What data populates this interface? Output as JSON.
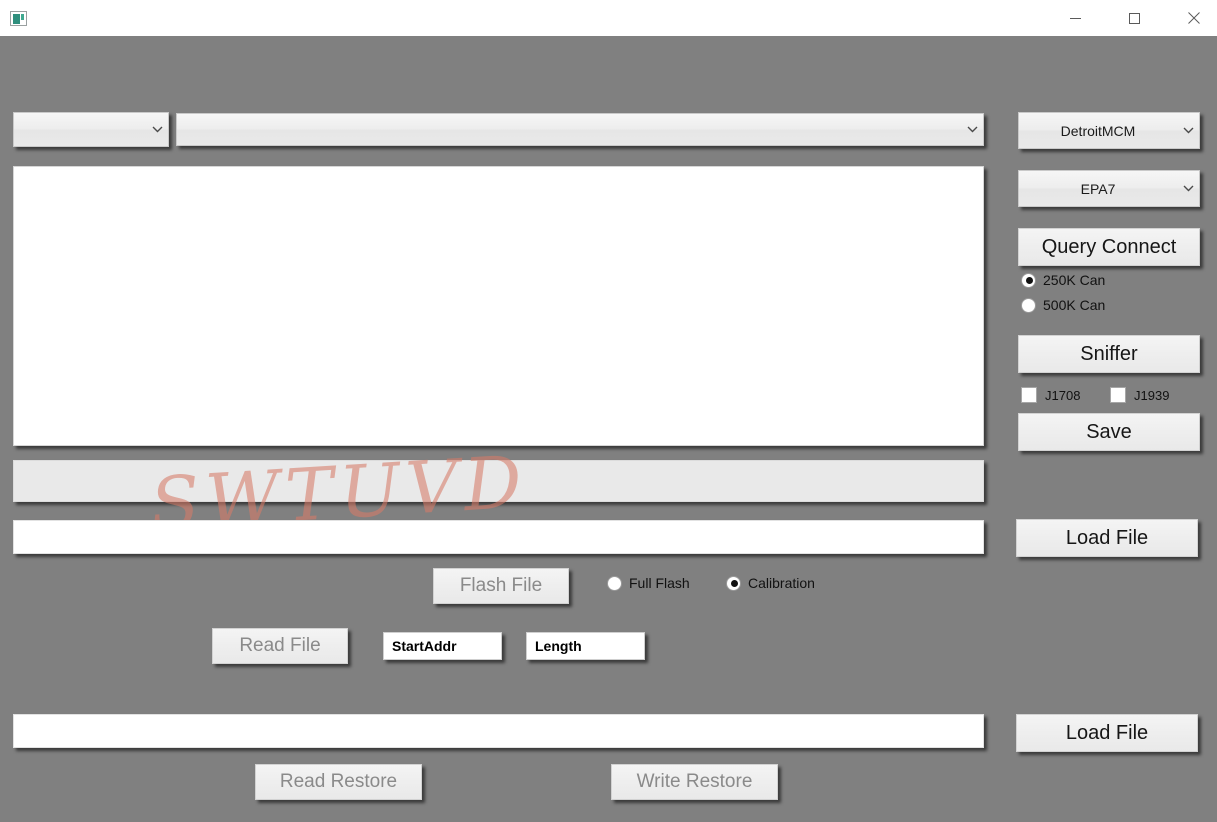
{
  "window": {
    "title": "",
    "icon": "app-window-icon",
    "controls": {
      "minimize": "minimize-icon",
      "maximize": "maximize-icon",
      "close": "close-icon"
    },
    "background_color": "#808080"
  },
  "watermark": {
    "text": "SWTUVD",
    "color": "#d67a68"
  },
  "top_bar": {
    "protocol_combo": {
      "value": "",
      "chevron": "chevron-down-icon"
    },
    "device_combo": {
      "value": "",
      "chevron": "chevron-down-icon"
    }
  },
  "log_area": {
    "value": ""
  },
  "progress_bar": {
    "value": "",
    "percent": 0
  },
  "file_paths": {
    "flash_path": {
      "value": "",
      "placeholder": ""
    },
    "restore_path": {
      "value": "",
      "placeholder": ""
    }
  },
  "flash_section": {
    "flash_file_label": "Flash File",
    "flash_file_enabled": false,
    "mode_options": [
      {
        "label": "Full Flash",
        "selected": false
      },
      {
        "label": "Calibration",
        "selected": true
      }
    ],
    "read_file_label": "Read File",
    "read_file_enabled": false,
    "start_addr": {
      "value": "StartAddr",
      "placeholder": "StartAddr"
    },
    "length": {
      "value": "Length",
      "placeholder": "Length"
    }
  },
  "restore_section": {
    "read_restore_label": "Read Restore",
    "write_restore_label": "Write Restore",
    "load_file_label": "Load File"
  },
  "side_panel": {
    "ecu_combo": {
      "value": "DetroitMCM",
      "chevron": "chevron-down-icon"
    },
    "epa_combo": {
      "value": "EPA7",
      "chevron": "chevron-down-icon"
    },
    "query_connect_label": "Query Connect",
    "can_speed_options": [
      {
        "label": "250K Can",
        "selected": true
      },
      {
        "label": "500K Can",
        "selected": false
      }
    ],
    "sniffer_label": "Sniffer",
    "protocol_checks": [
      {
        "label": "J1708",
        "checked": false
      },
      {
        "label": "J1939",
        "checked": false
      }
    ],
    "save_label": "Save",
    "load_file_label": "Load File"
  }
}
